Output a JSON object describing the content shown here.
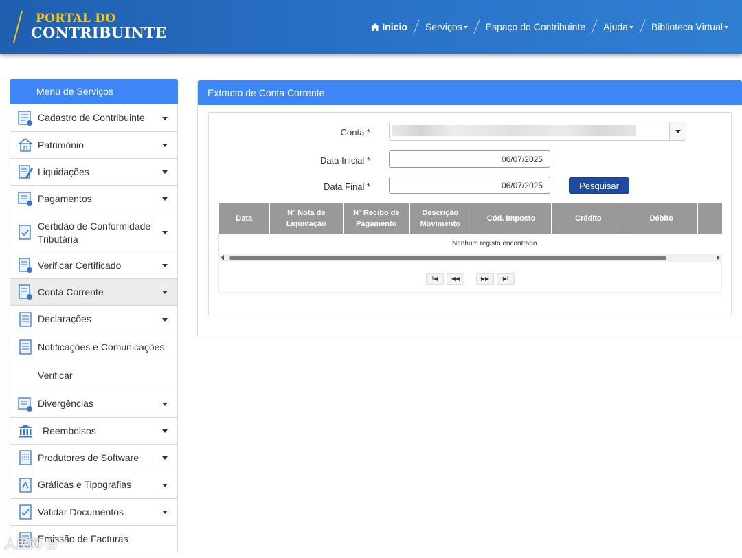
{
  "header": {
    "logo_line1": "PORTAL DO",
    "logo_line2": "CONTRIBUINTE",
    "nav": [
      {
        "label": "Inicio",
        "icon": "home-icon"
      },
      {
        "label": "Serviços",
        "dropdown": true
      },
      {
        "label": "Espaço do Contribuinte",
        "dropdown": false
      },
      {
        "label": "Ajuda",
        "dropdown": true
      },
      {
        "label": "Biblioteca Virtual",
        "dropdown": true
      }
    ]
  },
  "sidebar": {
    "title": "Menu de Serviços",
    "items": [
      {
        "label": "Cadastro de Contribuinte",
        "icon": "registry-icon",
        "caret": true
      },
      {
        "label": "Património",
        "icon": "house-icon",
        "caret": true
      },
      {
        "label": "Liquidações",
        "icon": "document-edit-icon",
        "caret": true
      },
      {
        "label": "Pagamentos",
        "icon": "payment-icon",
        "caret": true
      },
      {
        "label_line1": "Certidão de Conformidade",
        "label_line2": "Tributária",
        "icon": "certificate-icon",
        "caret": true
      },
      {
        "label": "Verificar Certificado",
        "icon": "verify-certificate-icon",
        "caret": true
      },
      {
        "label": "Conta Corrente",
        "icon": "account-icon",
        "caret": true,
        "active": true
      },
      {
        "label": "Declarações",
        "icon": "declaration-icon",
        "caret": true
      },
      {
        "label": "Notificações e Comunicações",
        "icon": "notification-icon",
        "caret": false
      },
      {
        "label": "Verificar",
        "icon": "",
        "caret": false
      },
      {
        "label": "Divergências",
        "icon": "divergence-icon",
        "caret": true
      },
      {
        "label": "Reembolsos",
        "icon": "bank-icon",
        "caret": true
      },
      {
        "label": "Produtores de Software",
        "icon": "software-icon",
        "caret": true
      },
      {
        "label": "Gráficas e Tipografias",
        "icon": "print-icon",
        "caret": true
      },
      {
        "label": "Validar Documentos",
        "icon": "validate-icon",
        "caret": true
      },
      {
        "label": "Emissão de Facturas",
        "icon": "invoice-icon",
        "caret": false
      }
    ]
  },
  "main": {
    "title": "Extracto de Conta Corrente",
    "form": {
      "conta_label": "Conta *",
      "data_inicial_label": "Data Inicial *",
      "data_inicial_value": "06/07/2025",
      "data_final_label": "Data Final *",
      "data_final_value": "06/07/2025",
      "search_button": "Pesquisar"
    },
    "table": {
      "columns": [
        {
          "line1": "Data",
          "line2": ""
        },
        {
          "line1": "Nº Nota de",
          "line2": "Liquidação"
        },
        {
          "line1": "Nº Recibo de",
          "line2": "Pagamento"
        },
        {
          "line1": "Descrição",
          "line2": "Movimento"
        },
        {
          "line1": "Cód. Imposto",
          "line2": ""
        },
        {
          "line1": "Crédito",
          "line2": ""
        },
        {
          "line1": "Débito",
          "line2": ""
        },
        {
          "line1": "",
          "line2": ""
        }
      ],
      "empty_message": "Nenhum registo encontrado"
    },
    "pager": {
      "first": "I◀",
      "prev": "◀◀",
      "next": "▶▶",
      "last": "▶I"
    }
  },
  "watermark": "人民网·日"
}
